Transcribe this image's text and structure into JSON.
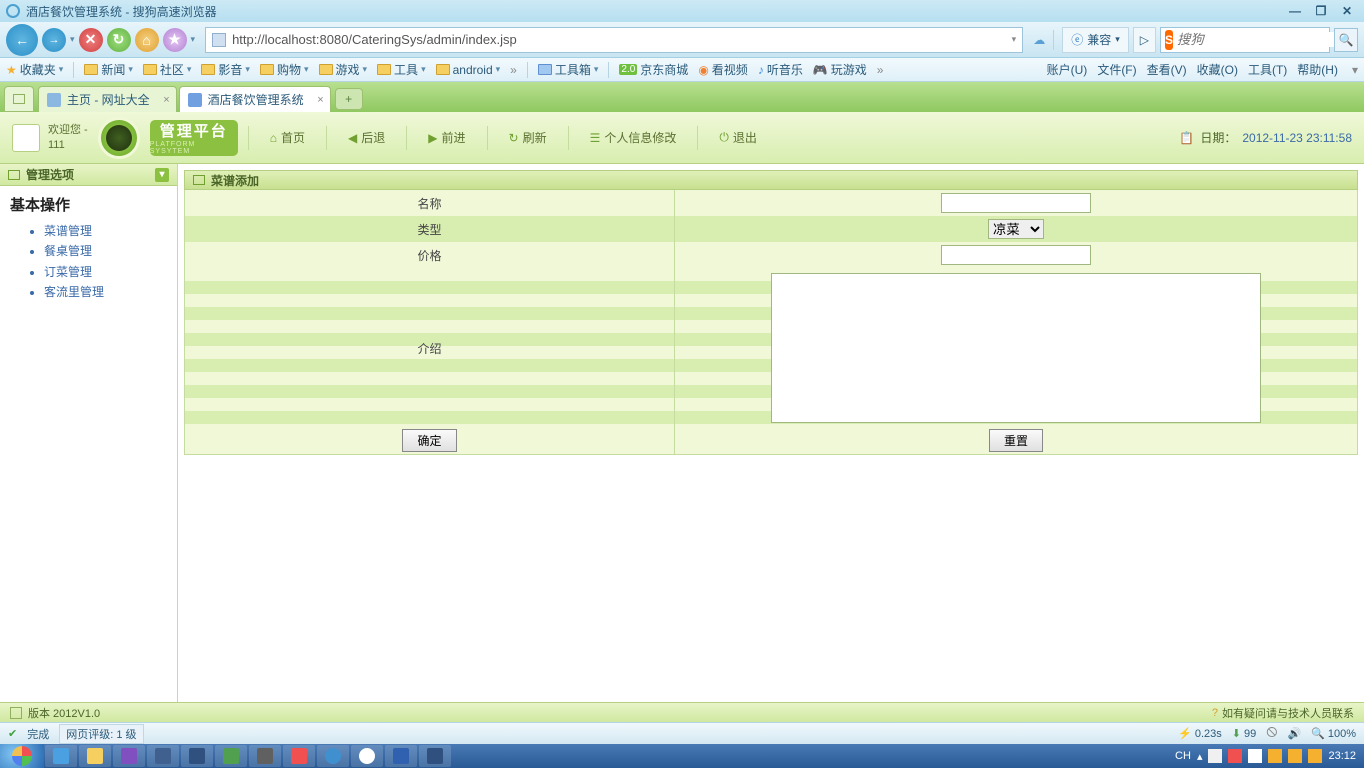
{
  "window": {
    "title": "酒店餐饮管理系统 - 搜狗高速浏览器"
  },
  "nav": {
    "url": "http://localhost:8080/CateringSys/admin/index.jsp",
    "compat": "兼容",
    "search_placeholder": "搜狗"
  },
  "bookmarks": {
    "fav": "收藏夹",
    "items": [
      "新闻",
      "社区",
      "影音",
      "购物",
      "游戏",
      "工具",
      "android"
    ],
    "toolbox": "工具箱",
    "quick": [
      "京东商城",
      "看视频",
      "听音乐",
      "玩游戏"
    ],
    "menus": [
      "账户(U)",
      "文件(F)",
      "查看(V)",
      "收藏(O)",
      "工具(T)",
      "帮助(H)"
    ]
  },
  "tabs": [
    {
      "label": "主页 - 网址大全",
      "active": false
    },
    {
      "label": "酒店餐饮管理系统",
      "active": true
    }
  ],
  "app": {
    "welcome_prefix": "欢迎您 -",
    "username": "111",
    "brand_cn": "管理平台",
    "brand_en": "PLATFORM SYSYTEM",
    "toolbar": {
      "home": "首页",
      "back": "后退",
      "forward": "前进",
      "refresh": "刷新",
      "profile": "个人信息修改",
      "logout": "退出"
    },
    "date_label": "日期：",
    "date_value": "2012-11-23 23:11:58"
  },
  "sidebar": {
    "header": "管理选项",
    "section": "基本操作",
    "items": [
      "菜谱管理",
      "餐桌管理",
      "订菜管理",
      "客流里管理"
    ]
  },
  "panel": {
    "title": "菜谱添加",
    "fields": {
      "name": "名称",
      "type": "类型",
      "price": "价格",
      "intro": "介绍"
    },
    "type_option": "凉菜",
    "submit": "确定",
    "reset": "重置"
  },
  "footer": {
    "version": "版本 2012V1.0",
    "contact": "如有疑问请与技术人员联系"
  },
  "status": {
    "done": "完成",
    "rating": "网页评级: 1 级",
    "time": "0.23s",
    "down": "99",
    "zoom": "100%"
  },
  "tray": {
    "ime": "CH",
    "clock": "23:12"
  },
  "jd_badge": "2.0"
}
